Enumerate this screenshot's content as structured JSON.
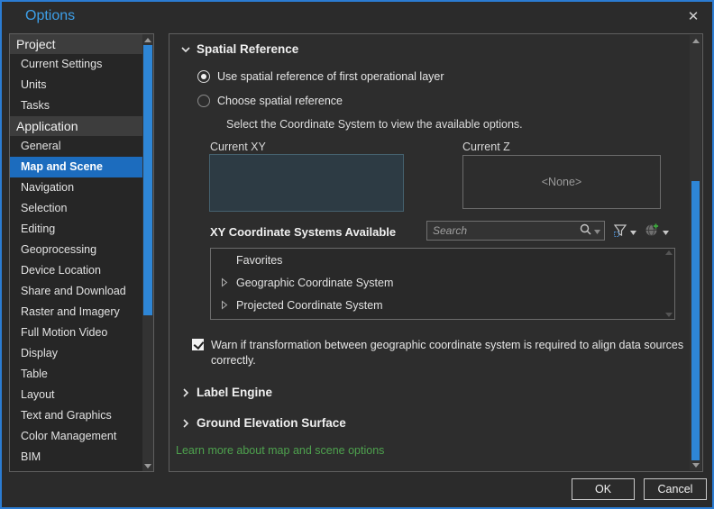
{
  "window": {
    "title": "Options",
    "close_label": "✕"
  },
  "colors": {
    "accent_blue": "#2b7cd3",
    "title_blue": "#3d9fe8",
    "selected_blue": "#1c6cbe",
    "scrollbar_blue": "#2e86d6",
    "link_green": "#4ea24e",
    "panel_bg": "#2d2d2d",
    "sidebar_bg": "#262626"
  },
  "icons": {
    "close": "close-icon",
    "search": "magnifier-icon",
    "filter": "funnel-icon",
    "globe": "globe-add-icon",
    "chevron_expanded": "chevron-down-icon",
    "chevron_collapsed": "chevron-right-icon"
  },
  "sidebar": {
    "sections": [
      {
        "header": "Project",
        "items": [
          {
            "label": "Current Settings"
          },
          {
            "label": "Units"
          },
          {
            "label": "Tasks"
          }
        ]
      },
      {
        "header": "Application",
        "items": [
          {
            "label": "General"
          },
          {
            "label": "Map and Scene",
            "selected": true
          },
          {
            "label": "Navigation"
          },
          {
            "label": "Selection"
          },
          {
            "label": "Editing"
          },
          {
            "label": "Geoprocessing"
          },
          {
            "label": "Device Location"
          },
          {
            "label": "Share and Download"
          },
          {
            "label": "Raster and Imagery"
          },
          {
            "label": "Full Motion Video"
          },
          {
            "label": "Display"
          },
          {
            "label": "Table"
          },
          {
            "label": "Layout"
          },
          {
            "label": "Text and Graphics"
          },
          {
            "label": "Color Management"
          },
          {
            "label": "BIM"
          }
        ]
      }
    ]
  },
  "main": {
    "spatial_reference": {
      "title": "Spatial Reference",
      "radio_first_layer": "Use spatial reference of first operational layer",
      "radio_choose": "Choose spatial reference",
      "instruction": "Select the Coordinate System to view the available options.",
      "current_xy_label": "Current XY",
      "current_z_label": "Current Z",
      "current_z_value": "<None>",
      "xy_available_label": "XY Coordinate Systems Available",
      "search_placeholder": "Search",
      "tree": [
        {
          "label": "Favorites",
          "expandable": false
        },
        {
          "label": "Geographic Coordinate System",
          "expandable": true
        },
        {
          "label": "Projected Coordinate System",
          "expandable": true
        }
      ],
      "warn_checkbox_label": "Warn if transformation between geographic coordinate system is required to align data sources correctly.",
      "warn_checkbox_checked": true
    },
    "collapsed_sections": [
      {
        "title": "Label Engine"
      },
      {
        "title": "Ground Elevation Surface"
      }
    ],
    "link_label": "Learn more about map and scene options"
  },
  "footer": {
    "ok_label": "OK",
    "cancel_label": "Cancel"
  }
}
